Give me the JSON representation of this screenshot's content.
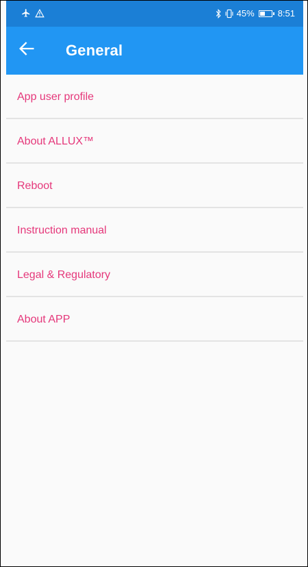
{
  "status_bar": {
    "left_icons": [
      "airplane-icon",
      "warning-icon"
    ],
    "right_icons": [
      "bluetooth-icon",
      "vibrate-icon"
    ],
    "battery_percent": "45%",
    "battery_level": 0.45,
    "time": "8:51"
  },
  "app_bar": {
    "title": "General",
    "back_icon": "arrow-left-icon"
  },
  "menu": {
    "items": [
      {
        "label": "App user profile"
      },
      {
        "label": "About ALLUX™"
      },
      {
        "label": "Reboot"
      },
      {
        "label": "Instruction manual"
      },
      {
        "label": "Legal & Regulatory"
      },
      {
        "label": "About APP"
      }
    ]
  },
  "colors": {
    "status_bar": "#1b7fd6",
    "app_bar": "#2196f3",
    "menu_text": "#e5377a",
    "divider": "#e3e3e3",
    "background": "#fafafa"
  }
}
